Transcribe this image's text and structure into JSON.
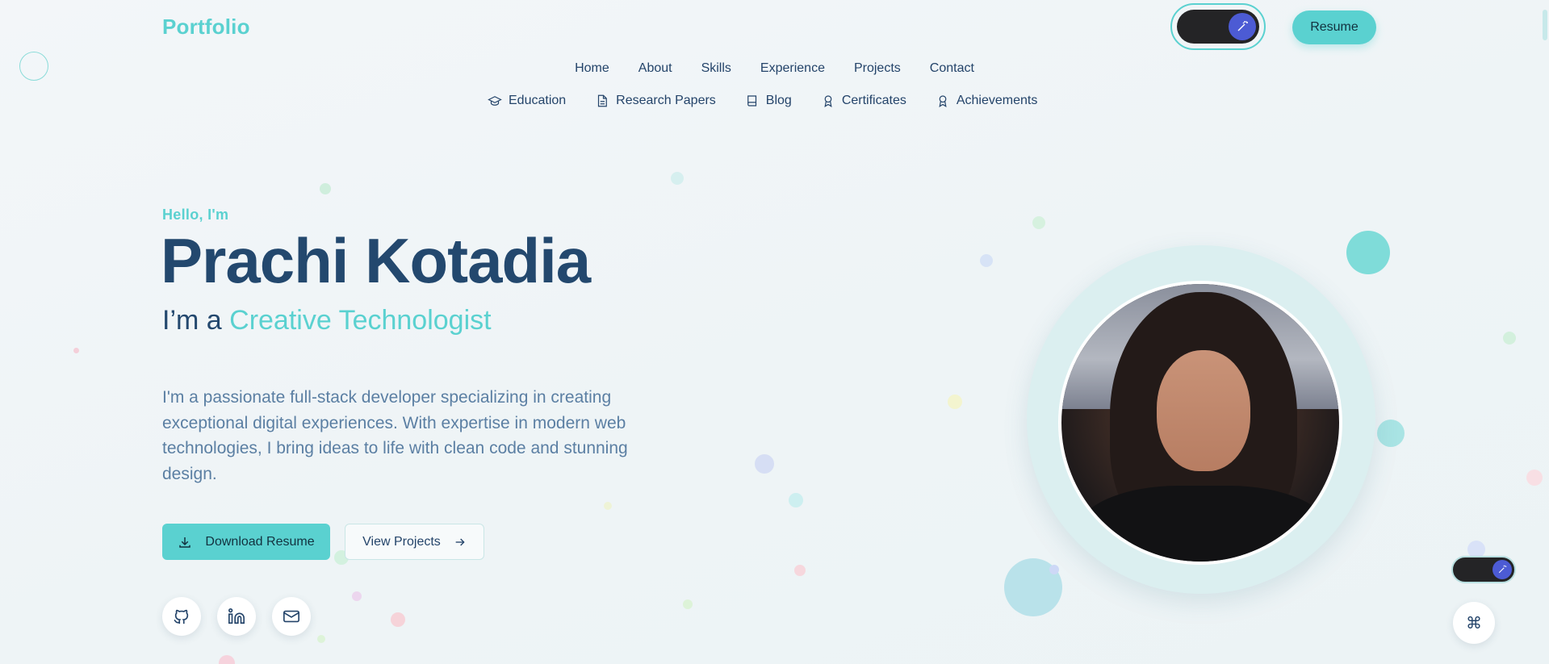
{
  "header": {
    "logo": "Portfolio",
    "resume_label": "Resume"
  },
  "nav_primary": [
    "Home",
    "About",
    "Skills",
    "Experience",
    "Projects",
    "Contact"
  ],
  "nav_secondary": [
    {
      "label": "Education",
      "icon": "graduation-cap-icon"
    },
    {
      "label": "Research Papers",
      "icon": "document-icon"
    },
    {
      "label": "Blog",
      "icon": "book-icon"
    },
    {
      "label": "Certificates",
      "icon": "award-icon"
    },
    {
      "label": "Achievements",
      "icon": "award-icon"
    }
  ],
  "hero": {
    "greeting": "Hello, I'm",
    "name": "Prachi Kotadia",
    "role_prefix": "I’m a",
    "role_accent": "Creative Technologist",
    "bio": "I'm a passionate full-stack developer specializing in creating exceptional digital experiences. With expertise in modern web technologies, I bring ideas to life with clean code and stunning design.",
    "download_label": "Download Resume",
    "projects_label": "View Projects"
  },
  "social": [
    "github-icon",
    "linkedin-icon",
    "mail-icon"
  ],
  "floating": {
    "command_symbol": "⌘"
  },
  "colors": {
    "accent": "#5ad1d0",
    "heading": "#23486e",
    "body_text": "#5b7fa3",
    "toggle_knob": "#4c5bd4"
  }
}
